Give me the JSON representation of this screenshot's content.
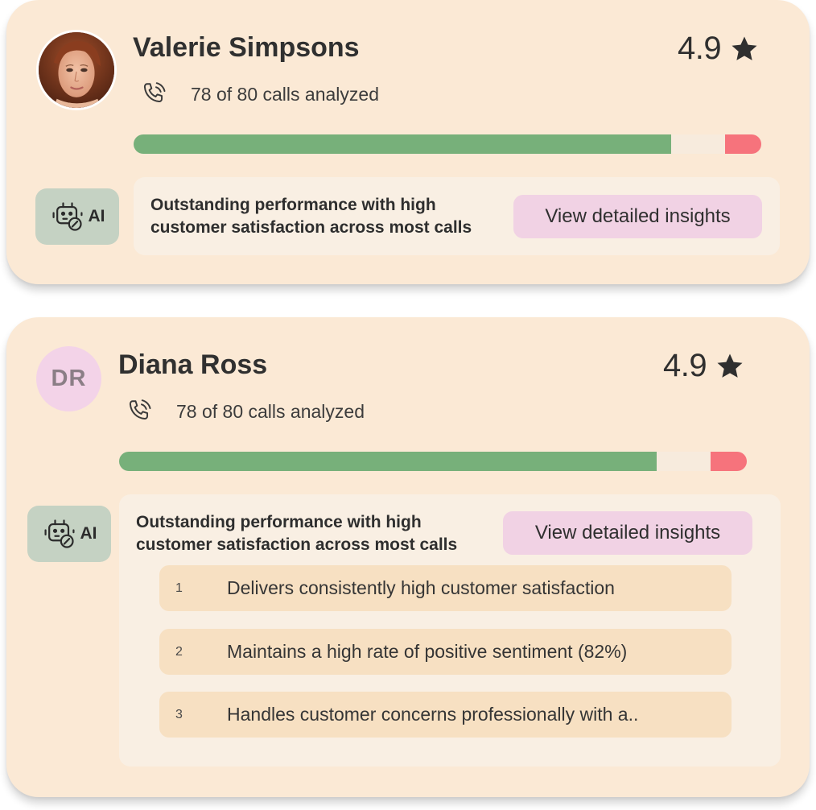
{
  "agents": [
    {
      "name": "Valerie Simpsons",
      "rating": "4.9",
      "calls_text": "78 of 80 calls analyzed",
      "avatar": "photo",
      "sentiment": {
        "positive": 0.856,
        "neutral": 0.086,
        "negative": 0.058
      },
      "ai_label": "AI",
      "summary_line1": "Outstanding performance with high",
      "summary_line2": "customer satisfaction across most calls",
      "button_label": "View detailed insights"
    },
    {
      "name": "Diana Ross",
      "initials": "DR",
      "rating": "4.9",
      "calls_text": "78 of 80 calls analyzed",
      "sentiment": {
        "positive": 0.856,
        "neutral": 0.086,
        "negative": 0.058
      },
      "ai_label": "AI",
      "summary_line1": "Outstanding performance with high",
      "summary_line2": "customer satisfaction across most calls",
      "button_label": "View detailed insights",
      "insights": [
        {
          "num": "1",
          "text": "Delivers consistently high customer satisfaction"
        },
        {
          "num": "2",
          "text": "Maintains a high rate of positive sentiment (82%)"
        },
        {
          "num": "3",
          "text": "Handles customer concerns professionally with a.."
        }
      ]
    }
  ],
  "icons": {
    "rating": "star-icon",
    "calls": "phone-call-icon",
    "ai": "robot-face-icon"
  },
  "colors": {
    "card_bg": "#fbe9d5",
    "positive": "#77b07a",
    "neutral": "#f7ebdd",
    "negative": "#f6737c",
    "ai_badge": "#c5d2c3",
    "button_bg": "#f1d2e4",
    "insight_item_bg": "#f7e0c2"
  }
}
